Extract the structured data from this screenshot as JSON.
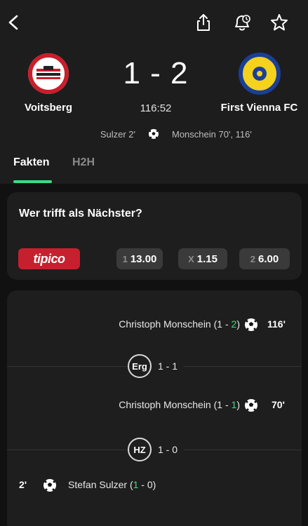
{
  "header": {
    "home_team": "Voitsberg",
    "away_team": "First Vienna FC",
    "score": "1 - 2",
    "clock": "116:52",
    "home_scorers": "Sulzer 2'",
    "away_scorers": "Monschein 70', 116'",
    "home_crest_text": "ASK VOITSBERG",
    "away_crest_text": "FIRST VIENNA FOOTBALL CLUB 1894"
  },
  "tabs": [
    {
      "label": "Fakten"
    },
    {
      "label": "H2H"
    }
  ],
  "odds": {
    "title": "Wer trifft als Nächster?",
    "bookmaker": "tipico",
    "options": [
      {
        "key": "1",
        "value": "13.00"
      },
      {
        "key": "X",
        "value": "1.15"
      },
      {
        "key": "2",
        "value": "6.00"
      }
    ]
  },
  "events": {
    "goal1": {
      "player": "Christoph Monschein",
      "home": "1",
      "away": "2",
      "minute": "116'"
    },
    "extra_time": {
      "label": "Erg",
      "score": "1 - 1"
    },
    "goal2": {
      "player": "Christoph Monschein",
      "home": "1",
      "away": "1",
      "minute": "70'"
    },
    "half_time": {
      "label": "HZ",
      "score": "1 - 0"
    },
    "goal3": {
      "player": "Stefan Sulzer",
      "home": "1",
      "away": "0",
      "minute": "2'"
    }
  },
  "colors": {
    "accent": "#3ddc84",
    "tipico": "#c6202e",
    "background": "#111111",
    "card": "#1e1e1e"
  }
}
